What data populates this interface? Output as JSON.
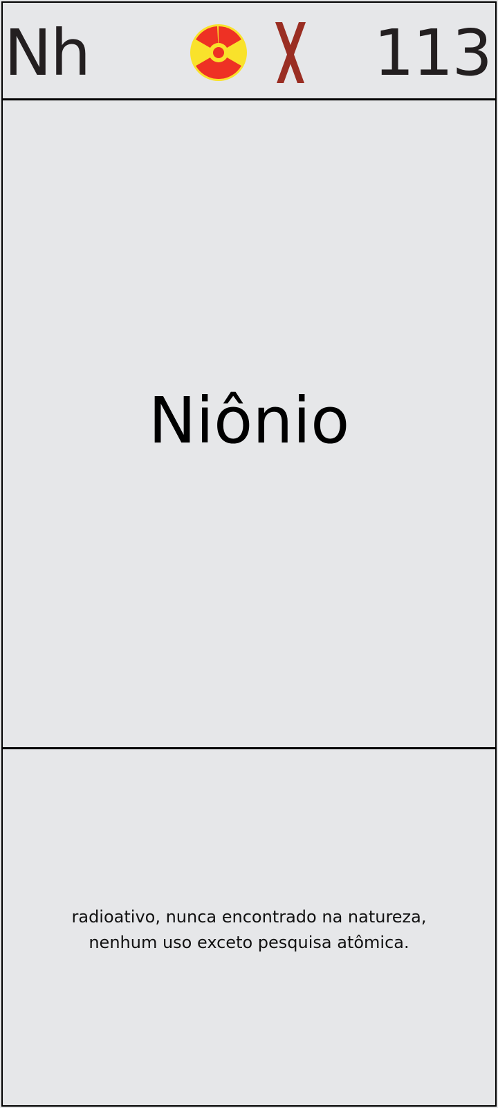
{
  "element": {
    "symbol": "Nh",
    "atomic_number": "113",
    "name": "Niônio",
    "description": "radioativo, nunca encontrado na natureza, nenhum uso exceto pesquisa atômica."
  },
  "icons": {
    "radiation": "radiation-icon",
    "synthetic": "synthetic-x-icon"
  },
  "colors": {
    "background": "#e6e7e9",
    "radiation_yellow": "#f9e22b",
    "radiation_red": "#ee3124",
    "synthetic_x": "#9a2e23"
  }
}
